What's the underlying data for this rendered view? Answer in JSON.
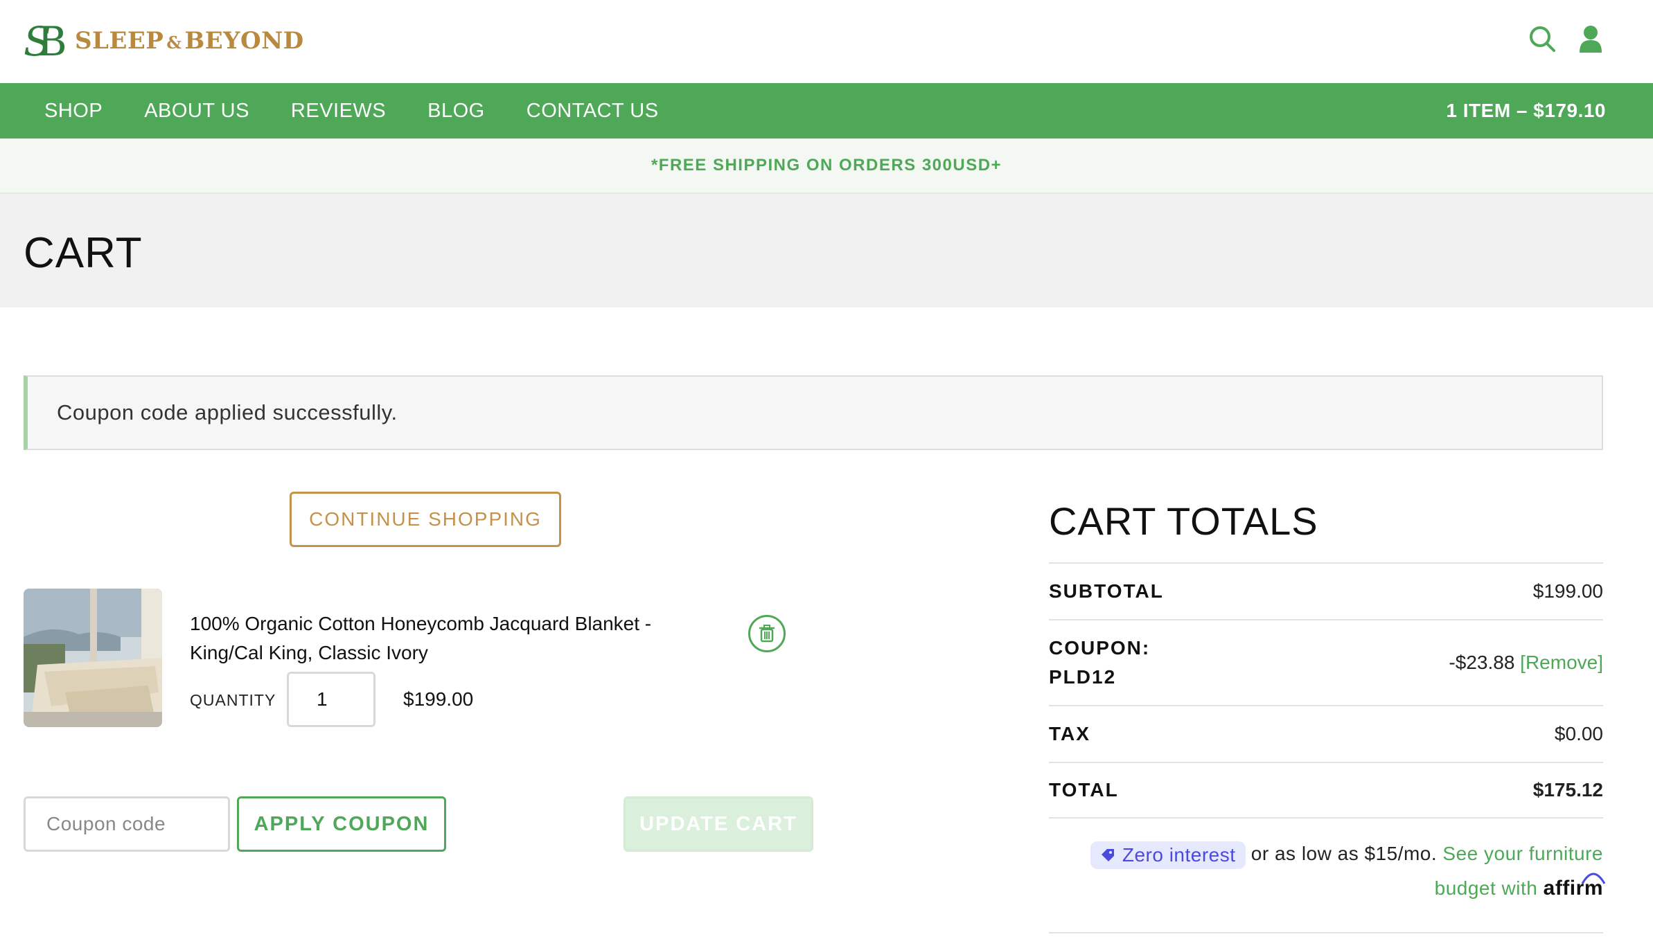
{
  "brand": {
    "name": "SLEEP & BEYOND",
    "left_word": "SLEEP",
    "amp": "&",
    "right_word": "BEYOND",
    "gold": "#b8893f",
    "green": "#2f7d3c"
  },
  "header": {
    "search_icon": "search-icon",
    "account_icon": "user-icon"
  },
  "nav": {
    "items": [
      {
        "label": "SHOP"
      },
      {
        "label": "ABOUT US"
      },
      {
        "label": "REVIEWS"
      },
      {
        "label": "BLOG"
      },
      {
        "label": "CONTACT US"
      }
    ],
    "cart_summary": "1 ITEM – $179.10",
    "bg_color": "#4ea858"
  },
  "banner": {
    "text": "*FREE SHIPPING ON ORDERS 300USD+"
  },
  "page": {
    "title": "CART"
  },
  "notice": {
    "text": "Coupon code applied successfully."
  },
  "cart": {
    "continue_label": "CONTINUE SHOPPING",
    "item": {
      "name": "100% Organic Cotton Honeycomb Jacquard Blanket - King/Cal King, Classic Ivory",
      "quantity_label": "QUANTITY",
      "quantity": "1",
      "price": "$199.00"
    },
    "coupon_placeholder": "Coupon code",
    "apply_label": "APPLY COUPON",
    "update_label": "UPDATE CART"
  },
  "totals": {
    "title": "CART TOTALS",
    "subtotal_label": "SUBTOTAL",
    "subtotal_value": "$199.00",
    "coupon_label_line1": "COUPON:",
    "coupon_label_line2": "PLD12",
    "coupon_value": "-$23.88",
    "coupon_remove": "[Remove]",
    "tax_label": "TAX",
    "tax_value": "$0.00",
    "total_label": "TOTAL",
    "total_value": "$175.12"
  },
  "affirm": {
    "pill": "Zero interest",
    "text": "or as low as $15/mo.",
    "link": "See your furniture budget with",
    "logo": "affirm"
  }
}
